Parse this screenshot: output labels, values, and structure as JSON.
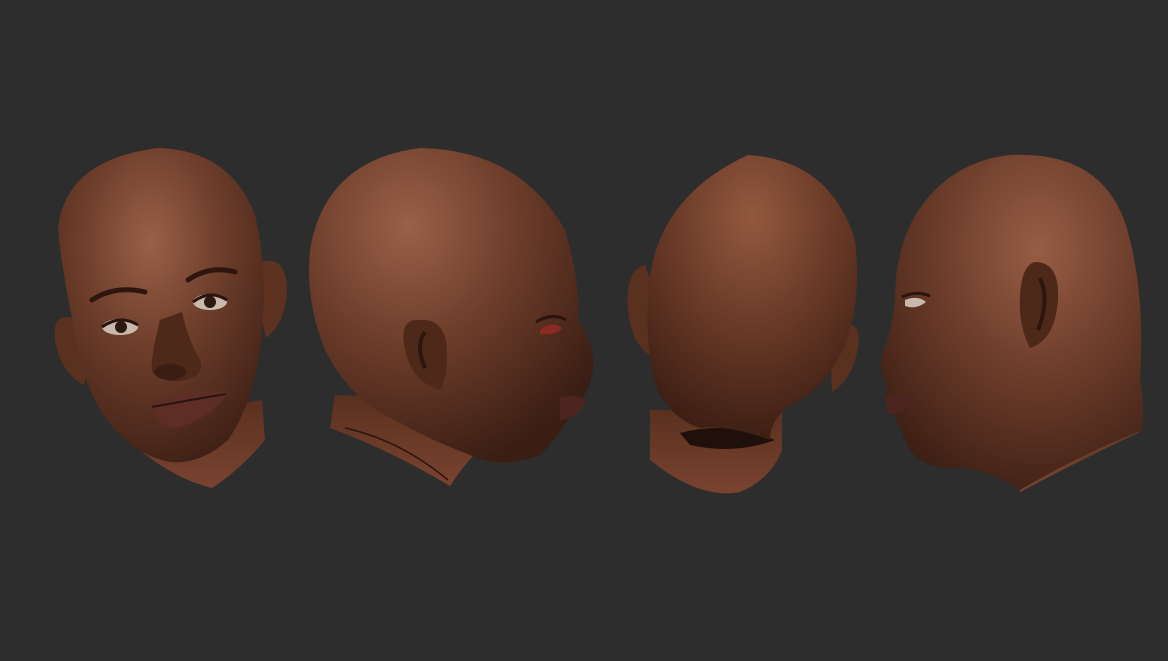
{
  "canvas": {
    "background": "#2d2d2d"
  },
  "skin": {
    "highlight": "#9a6048",
    "mid": "#6e3e2b",
    "shadow": "#3e1f15",
    "dark": "#2a140d",
    "lip": "#5e2e26",
    "eye_white": "#c9b9ad",
    "iris": "#2b1810"
  },
  "views": [
    {
      "name": "front",
      "icon": "head-front-view"
    },
    {
      "name": "three-quarter-right",
      "icon": "head-three-quarter-view"
    },
    {
      "name": "back",
      "icon": "head-back-view"
    },
    {
      "name": "profile-left",
      "icon": "head-profile-view"
    }
  ]
}
